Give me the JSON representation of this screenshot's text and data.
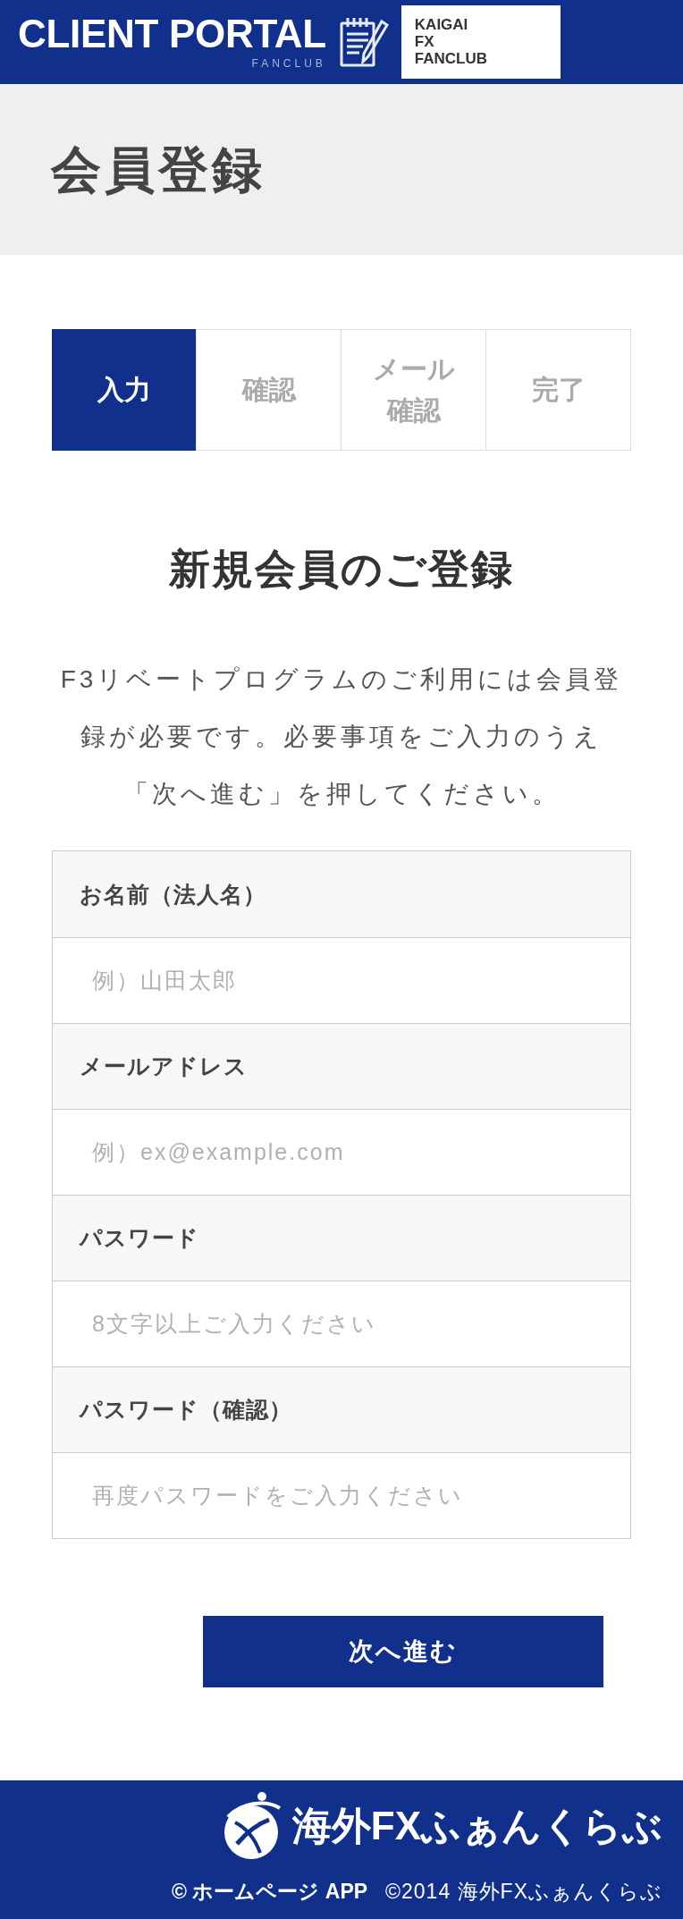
{
  "header": {
    "title": "CLIENT PORTAL",
    "subtitle": "FANCLUB",
    "logo_text": "KAIGAI FX FANCLUB"
  },
  "page_title": "会員登録",
  "steps": [
    {
      "label": "入力",
      "selected": true
    },
    {
      "label": "確認",
      "selected": false
    },
    {
      "label": "メール確認",
      "selected": false
    },
    {
      "label": "完了",
      "selected": false
    }
  ],
  "heading": "新規会員のご登録",
  "intro": "F3リベートプログラムのご利用には会員登録が必要です。必要事項をご入力のうえ「次へ進む」を押してください。",
  "form": {
    "fields": [
      {
        "label": "お名前（法人名）",
        "placeholder": "例）山田太郎"
      },
      {
        "label": "メールアドレス",
        "placeholder": "例）ex@example.com"
      },
      {
        "label": "パスワード",
        "placeholder": "8文字以上ご入力ください"
      },
      {
        "label": "パスワード（確認）",
        "placeholder": "再度パスワードをご入力ください"
      }
    ]
  },
  "submit_button": "次へ進む",
  "footer": {
    "logo_text": "海外FXふぁんくらぶ",
    "builder_badge": "© ホームページ APP",
    "copyright": "©2014 海外FXふぁんくらぶ"
  }
}
